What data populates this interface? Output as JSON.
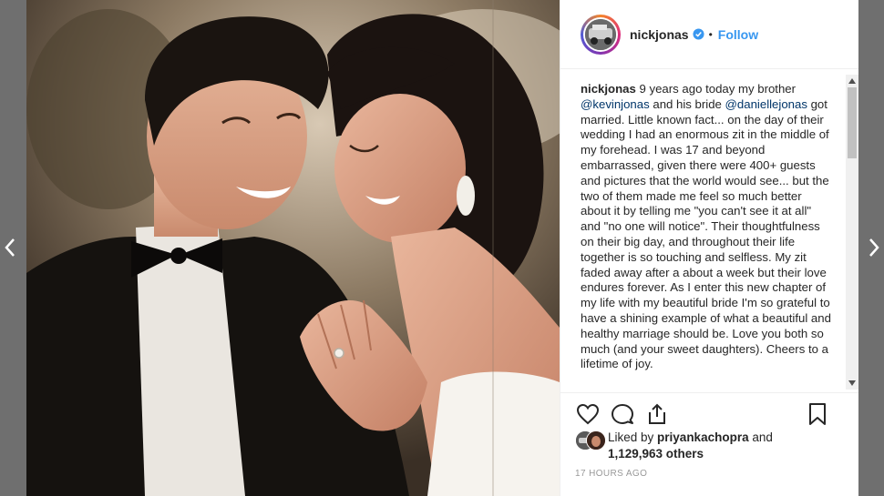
{
  "post": {
    "username": "nickjonas",
    "follow_label": "Follow",
    "separator": "•",
    "caption": {
      "username": "nickjonas",
      "p1": " 9 years ago today my brother ",
      "mention1": "@kevinjonas",
      "p2": " and his bride ",
      "mention2": "@daniellejonas",
      "p3": " got married. Little known fact... on the day of their wedding I had an enormous zit in the middle of my forehead. I was 17 and beyond embarrassed, given there were 400+ guests and pictures that the world would see... but the two of them made me feel so much better about it by telling me \"you can't see it at all\" and \"no one will notice\". Their thoughtfulness on their big day, and throughout their life together is so touching and selfless. My zit faded away after a about a week but their love endures forever. As I enter this new chapter of my life with my beautiful bride I'm so grateful to have a shining example of what a beautiful and healthy marriage should be. Love you both so much (and your sweet daughters). Cheers to a lifetime of joy."
    },
    "likes": {
      "prefix": "Liked by ",
      "liked_by_user": "priyankachopra",
      "and": " and",
      "count": "1,129,963 others"
    },
    "timestamp": "17 HOURS AGO"
  },
  "icons": {
    "prev": "chevron-left-icon",
    "next": "chevron-right-icon",
    "like": "heart-icon",
    "comment": "comment-icon",
    "share": "share-icon",
    "save": "bookmark-icon",
    "verified": "verified-badge-icon"
  },
  "colors": {
    "link": "#003569",
    "follow": "#3897f0",
    "text": "#262626",
    "muted": "#999999",
    "backdrop": "#6f6f6f"
  }
}
